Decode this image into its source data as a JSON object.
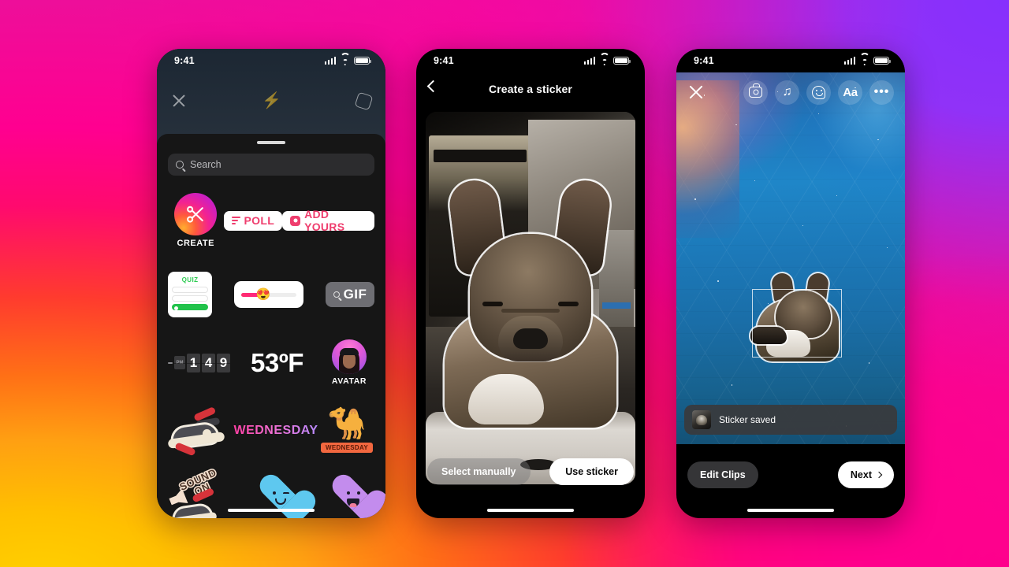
{
  "background": {
    "colors": [
      "#ff0b80",
      "#8430ff",
      "#ffd100",
      "#ff3b2e",
      "#e4169f"
    ]
  },
  "phones": {
    "left": {
      "name": "sticker-tray",
      "statusbar": {
        "time": "9:41",
        "signal_icon": "cellular-signal-icon",
        "wifi_icon": "wifi-icon",
        "battery_icon": "battery-icon"
      },
      "story_top": {
        "close_icon": "close-icon",
        "bolt_icon": "bolt-icon",
        "hexagon_icon": "hexagon-icon"
      },
      "search": {
        "placeholder": "Search",
        "icon": "search-icon"
      },
      "stickers": {
        "create_label": "CREATE",
        "poll_label": "POLL",
        "add_yours_label": "ADD YOURS",
        "quiz_label": "QUIZ",
        "slider_emoji": "😍",
        "gif_label": "GIF",
        "countdown_digits": [
          "1",
          "4",
          "9"
        ],
        "countdown_unit": "PM",
        "temperature": "53ºF",
        "avatar_label": "AVATAR",
        "wednesday_label": "WEDNESDAY",
        "camel_emoji": "🐪",
        "camel_badge": "WEDNESDAY",
        "sound_on_line1": "SOUND",
        "sound_on_line2": "ON"
      }
    },
    "middle": {
      "name": "create-a-sticker",
      "statusbar": {
        "time": "9:41"
      },
      "nav": {
        "back_icon": "chevron-left-icon",
        "title": "Create a sticker"
      },
      "buttons": {
        "select_manually": "Select manually",
        "use_sticker": "Use sticker"
      }
    },
    "right": {
      "name": "story-editor",
      "statusbar": {
        "time": "9:41"
      },
      "toolbar": {
        "close_icon": "close-icon",
        "items": [
          {
            "icon": "camera-icon",
            "label": ""
          },
          {
            "icon": "music-note-icon",
            "label": "♫"
          },
          {
            "icon": "sticker-icon",
            "label": ""
          },
          {
            "icon": "text-icon",
            "label": "Aa"
          },
          {
            "icon": "more-icon",
            "label": "•••"
          }
        ]
      },
      "toast": {
        "icon": "sticker-thumbnail",
        "message": "Sticker saved"
      },
      "buttons": {
        "edit_clips": "Edit Clips",
        "next": "Next",
        "next_icon": "chevron-right-icon"
      }
    }
  }
}
